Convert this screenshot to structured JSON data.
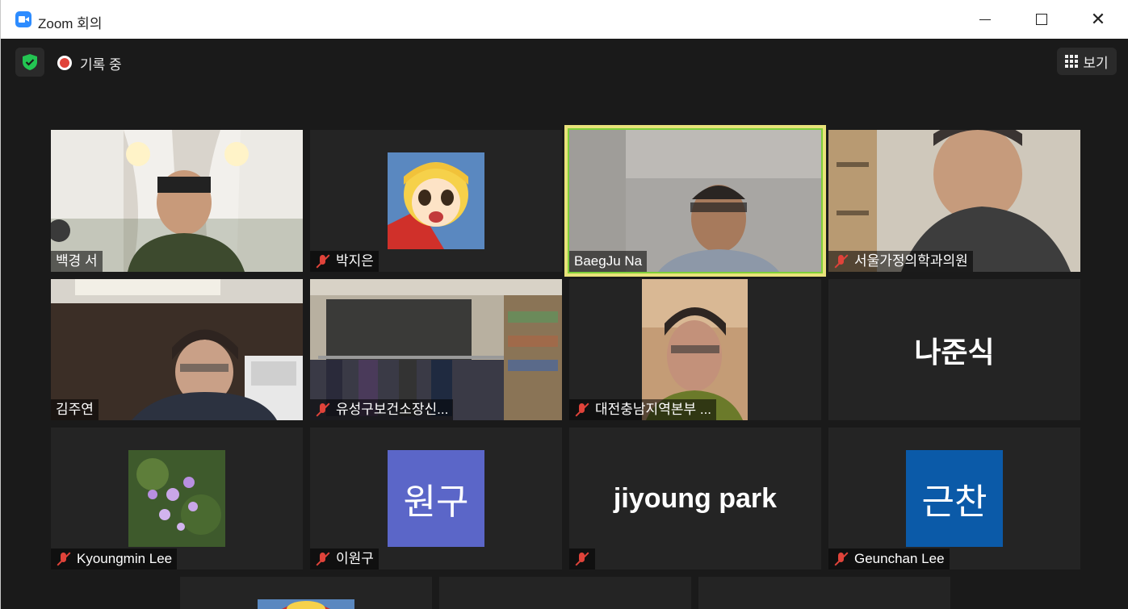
{
  "window": {
    "title": "Zoom 회의"
  },
  "topbar": {
    "recording_label": "기록 중",
    "view_label": "보기"
  },
  "participants": [
    {
      "name": "백경 서"
    },
    {
      "name": "박지은"
    },
    {
      "name": "BaegJu Na"
    },
    {
      "name": "서울가정의학과의원"
    },
    {
      "name": "김주연"
    },
    {
      "name": "유성구보건소장신..."
    },
    {
      "name": "대전충남지역본부 ..."
    },
    {
      "name": "나준식"
    },
    {
      "name": "Kyoungmin Lee"
    },
    {
      "name": "이원구",
      "avatar_text": "원구"
    },
    {
      "name": "jiyoung park"
    },
    {
      "name": "Geunchan Lee",
      "avatar_text": "근찬"
    }
  ],
  "colors": {
    "avatar_purple": "#5b66c8",
    "avatar_blue": "#0b5aa8",
    "active_speaker_border": "#e9e27a",
    "mic_off": "#e0433a"
  }
}
